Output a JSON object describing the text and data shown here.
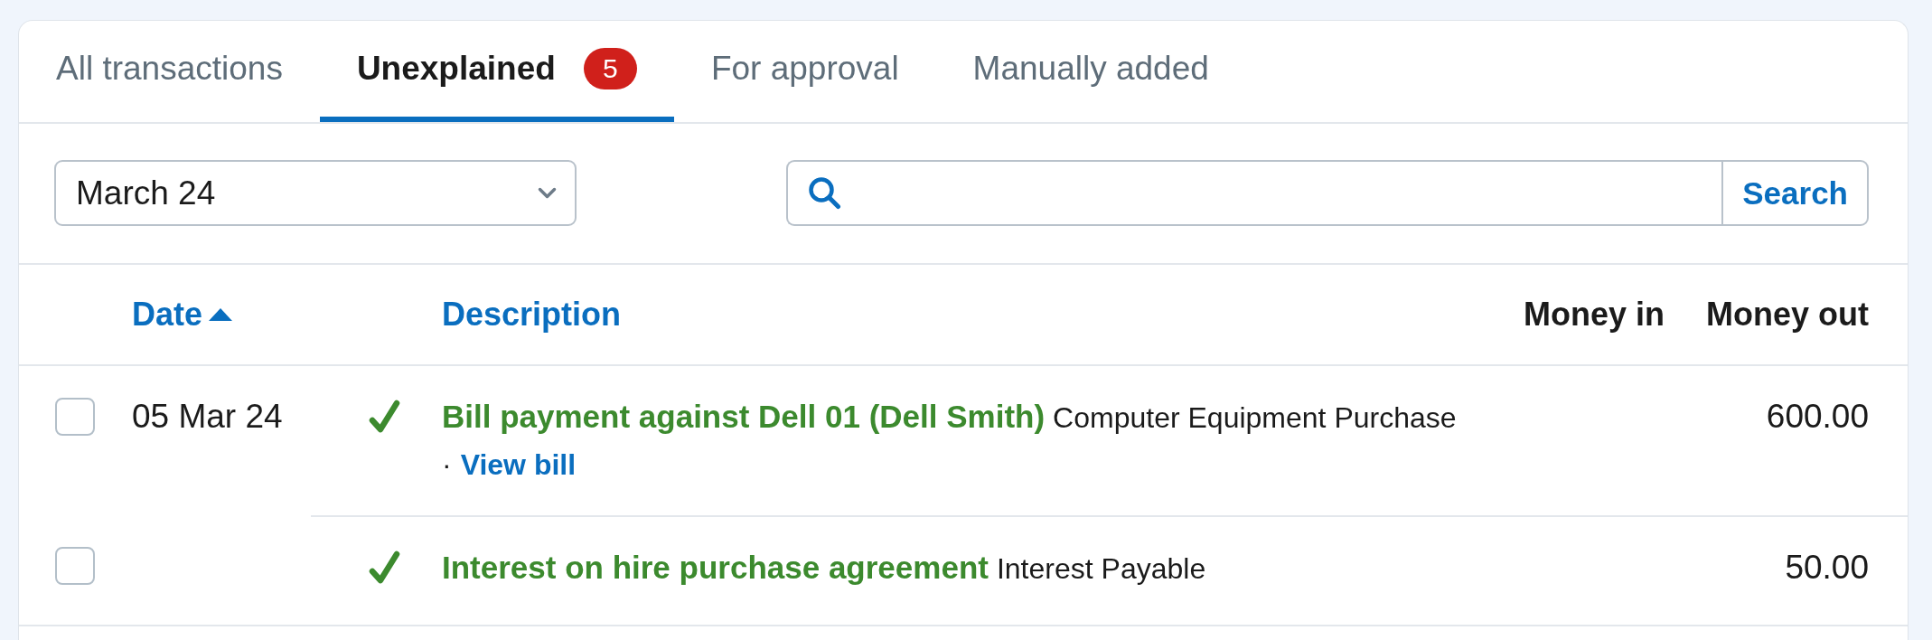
{
  "tabs": [
    {
      "label": "All transactions",
      "selected": false
    },
    {
      "label": "Unexplained",
      "selected": true,
      "badge": "5"
    },
    {
      "label": "For approval",
      "selected": false
    },
    {
      "label": "Manually added",
      "selected": false
    }
  ],
  "filters": {
    "period": {
      "value": "March 24"
    },
    "search": {
      "button": "Search"
    }
  },
  "table": {
    "columns": [
      {
        "label": "Date",
        "sortable": true,
        "sorted": true
      },
      {
        "label": "Description",
        "sortable": true,
        "sorted": false
      },
      {
        "label": "Money in",
        "sortable": false
      },
      {
        "label": "Money out",
        "sortable": false
      }
    ],
    "rows": [
      {
        "checked": false,
        "date": "05 Mar 24",
        "explained": true,
        "title": "Bill payment against Dell 01 (Dell Smith)",
        "category": "Computer Equipment Purchase",
        "separator": "·",
        "link": "View bill",
        "money_out": "600.00"
      },
      {
        "checked": false,
        "explained": true,
        "title": "Interest on hire purchase agreement",
        "category": "Interest Payable",
        "money_out": "50.00"
      }
    ]
  }
}
